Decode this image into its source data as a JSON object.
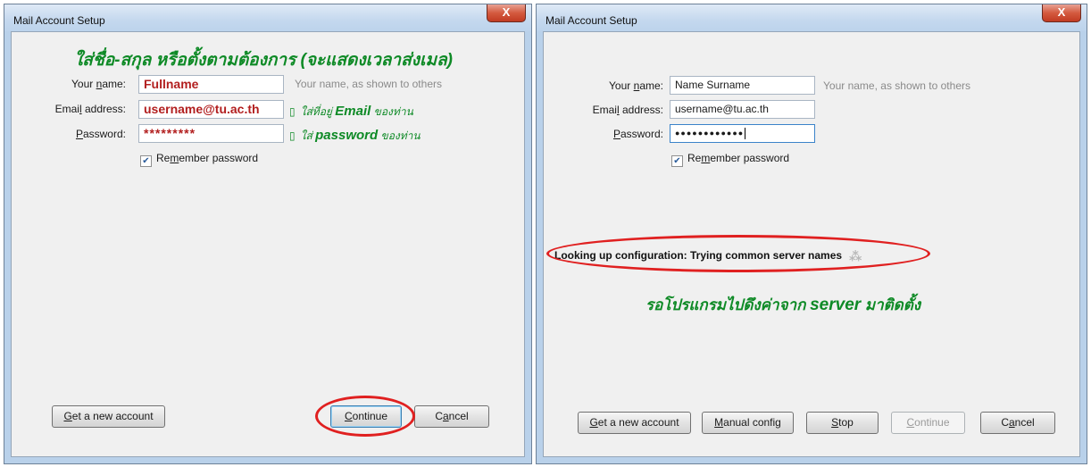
{
  "left": {
    "title": "Mail Account Setup",
    "close_glyph": "X",
    "annotation_heading": "ใส่ชื่อ-สกุล หรือตั้งตามต้องการ (จะแสดงเวลาส่งเมล)",
    "name_label_pre": "Your ",
    "name_label_key": "n",
    "name_label_post": "ame:",
    "name_value": "Fullname",
    "name_hint": "Your name, as shown to others",
    "email_label_pre": "Emai",
    "email_label_key": "l",
    "email_label_post": " address:",
    "email_value": "username@tu.ac.th",
    "email_annotation_mark": "▯",
    "email_annotation_pre": "ใส่ที่อยู่ ",
    "email_annotation_bold": "Email",
    "email_annotation_post": " ของท่าน",
    "password_label_key": "P",
    "password_label_post": "assword:",
    "password_value": "*********",
    "password_annotation_mark": "▯",
    "password_annotation_pre": "ใส่ ",
    "password_annotation_bold": "password",
    "password_annotation_post": " ของท่าน",
    "remember_pre": "Re",
    "remember_key": "m",
    "remember_post": "ember password",
    "remember_checked": "✔",
    "btn_new_key": "G",
    "btn_new_post": "et a new account",
    "btn_continue_key": "C",
    "btn_continue_post": "ontinue",
    "btn_cancel_pre": "C",
    "btn_cancel_key": "a",
    "btn_cancel_post": "ncel"
  },
  "right": {
    "title": "Mail Account Setup",
    "close_glyph": "X",
    "name_label_pre": "Your ",
    "name_label_key": "n",
    "name_label_post": "ame:",
    "name_value": "Name Surname",
    "name_hint": "Your name, as shown to others",
    "email_label_pre": "Emai",
    "email_label_key": "l",
    "email_label_post": " address:",
    "email_value": "username@tu.ac.th",
    "password_label_key": "P",
    "password_label_post": "assword:",
    "password_value": "●●●●●●●●●●●●",
    "remember_pre": "Re",
    "remember_key": "m",
    "remember_post": "ember password",
    "remember_checked": "✔",
    "status_text": "Looking up configuration: Trying common server names",
    "spinner_glyph": "⁂",
    "annotation_pre": "รอโปรแกรมไปดึงค่าจาก ",
    "annotation_bold": "server",
    "annotation_post": " มาติดตั้ง",
    "btn_new_key": "G",
    "btn_new_post": "et a new account",
    "btn_manual_key": "M",
    "btn_manual_post": "anual config",
    "btn_stop_key": "S",
    "btn_stop_post": "top",
    "btn_continue_key": "C",
    "btn_continue_post": "ontinue",
    "btn_cancel_pre": "C",
    "btn_cancel_key": "a",
    "btn_cancel_post": "ncel"
  },
  "colors": {
    "annotation_green": "#0e8a26",
    "highlight_red": "#b21f1f",
    "ellipse_red": "#e02020"
  }
}
